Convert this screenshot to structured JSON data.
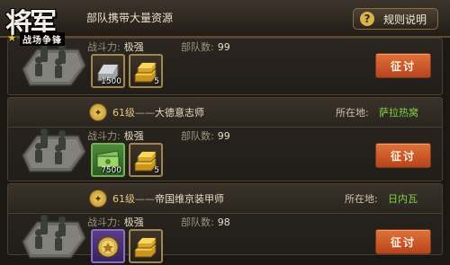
{
  "header": {
    "logo_main": "将军",
    "logo_sub": "战场争锋",
    "title": "部队携带大量资源",
    "rules_label": "规则说明"
  },
  "labels": {
    "power": "战斗力:",
    "troops": "部队数:",
    "location": "所在地:",
    "attack": "征讨"
  },
  "cards": [
    {
      "power": "极强",
      "troops": "99",
      "rewards": [
        {
          "icon": "iron-ingot-icon",
          "count": "1500"
        },
        {
          "icon": "gold-ingot-icon",
          "count": "5"
        }
      ]
    },
    {
      "level": "61级",
      "dash": "——",
      "name": "大德意志师",
      "location": "萨拉热窝",
      "power": "极强",
      "troops": "99",
      "rewards": [
        {
          "icon": "cash-icon",
          "count": "7500"
        },
        {
          "icon": "gold-ingot-icon",
          "count": "5"
        }
      ]
    },
    {
      "level": "61级",
      "dash": "——",
      "name": "帝国维京装甲师",
      "location": "日内瓦",
      "power": "极强",
      "troops": "98",
      "rewards": [
        {
          "icon": "medal-icon",
          "count": ""
        },
        {
          "icon": "gold-ingot-icon",
          "count": ""
        }
      ]
    }
  ],
  "colors": {
    "location_value": "#7fd24a",
    "attack_button": "#d25d2c",
    "level": "#e4c880"
  }
}
